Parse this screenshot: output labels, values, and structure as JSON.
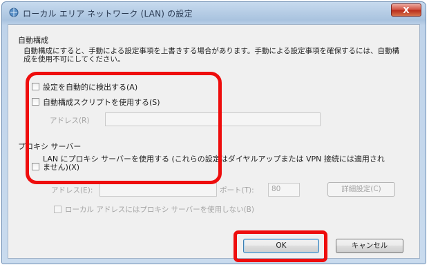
{
  "window": {
    "title": "ローカル エリア ネットワーク (LAN) の設定",
    "close_label": "X"
  },
  "auto_config": {
    "section_label": "自動構成",
    "description": "自動構成にすると、手動による設定事項を上書きする場合があります。手動による設定事項を確保するには、自動構成を使用不可にしてください。",
    "detect_label": "設定を自動的に検出する(A)",
    "script_label": "自動構成スクリプトを使用する(S)",
    "address_label": "アドレス(R)",
    "address_value": ""
  },
  "proxy": {
    "section_label": "プロキシ サーバー",
    "use_proxy_label": "LAN にプロキシ サーバーを使用する (これらの設定はダイヤルアップまたは VPN 接続には適用されません)(X)",
    "address_label": "アドレス(E):",
    "address_value": "",
    "port_label": "ポート(T):",
    "port_value": "80",
    "advanced_label": "詳細設定(C)",
    "bypass_label": "ローカル アドレスにはプロキシ サーバーを使用しない(B)"
  },
  "buttons": {
    "ok_label": "OK",
    "cancel_label": "キャンセル"
  },
  "colors": {
    "highlight": "#ee0d0d",
    "title_bar": "#b3cbe5",
    "close_button": "#c7432f"
  }
}
